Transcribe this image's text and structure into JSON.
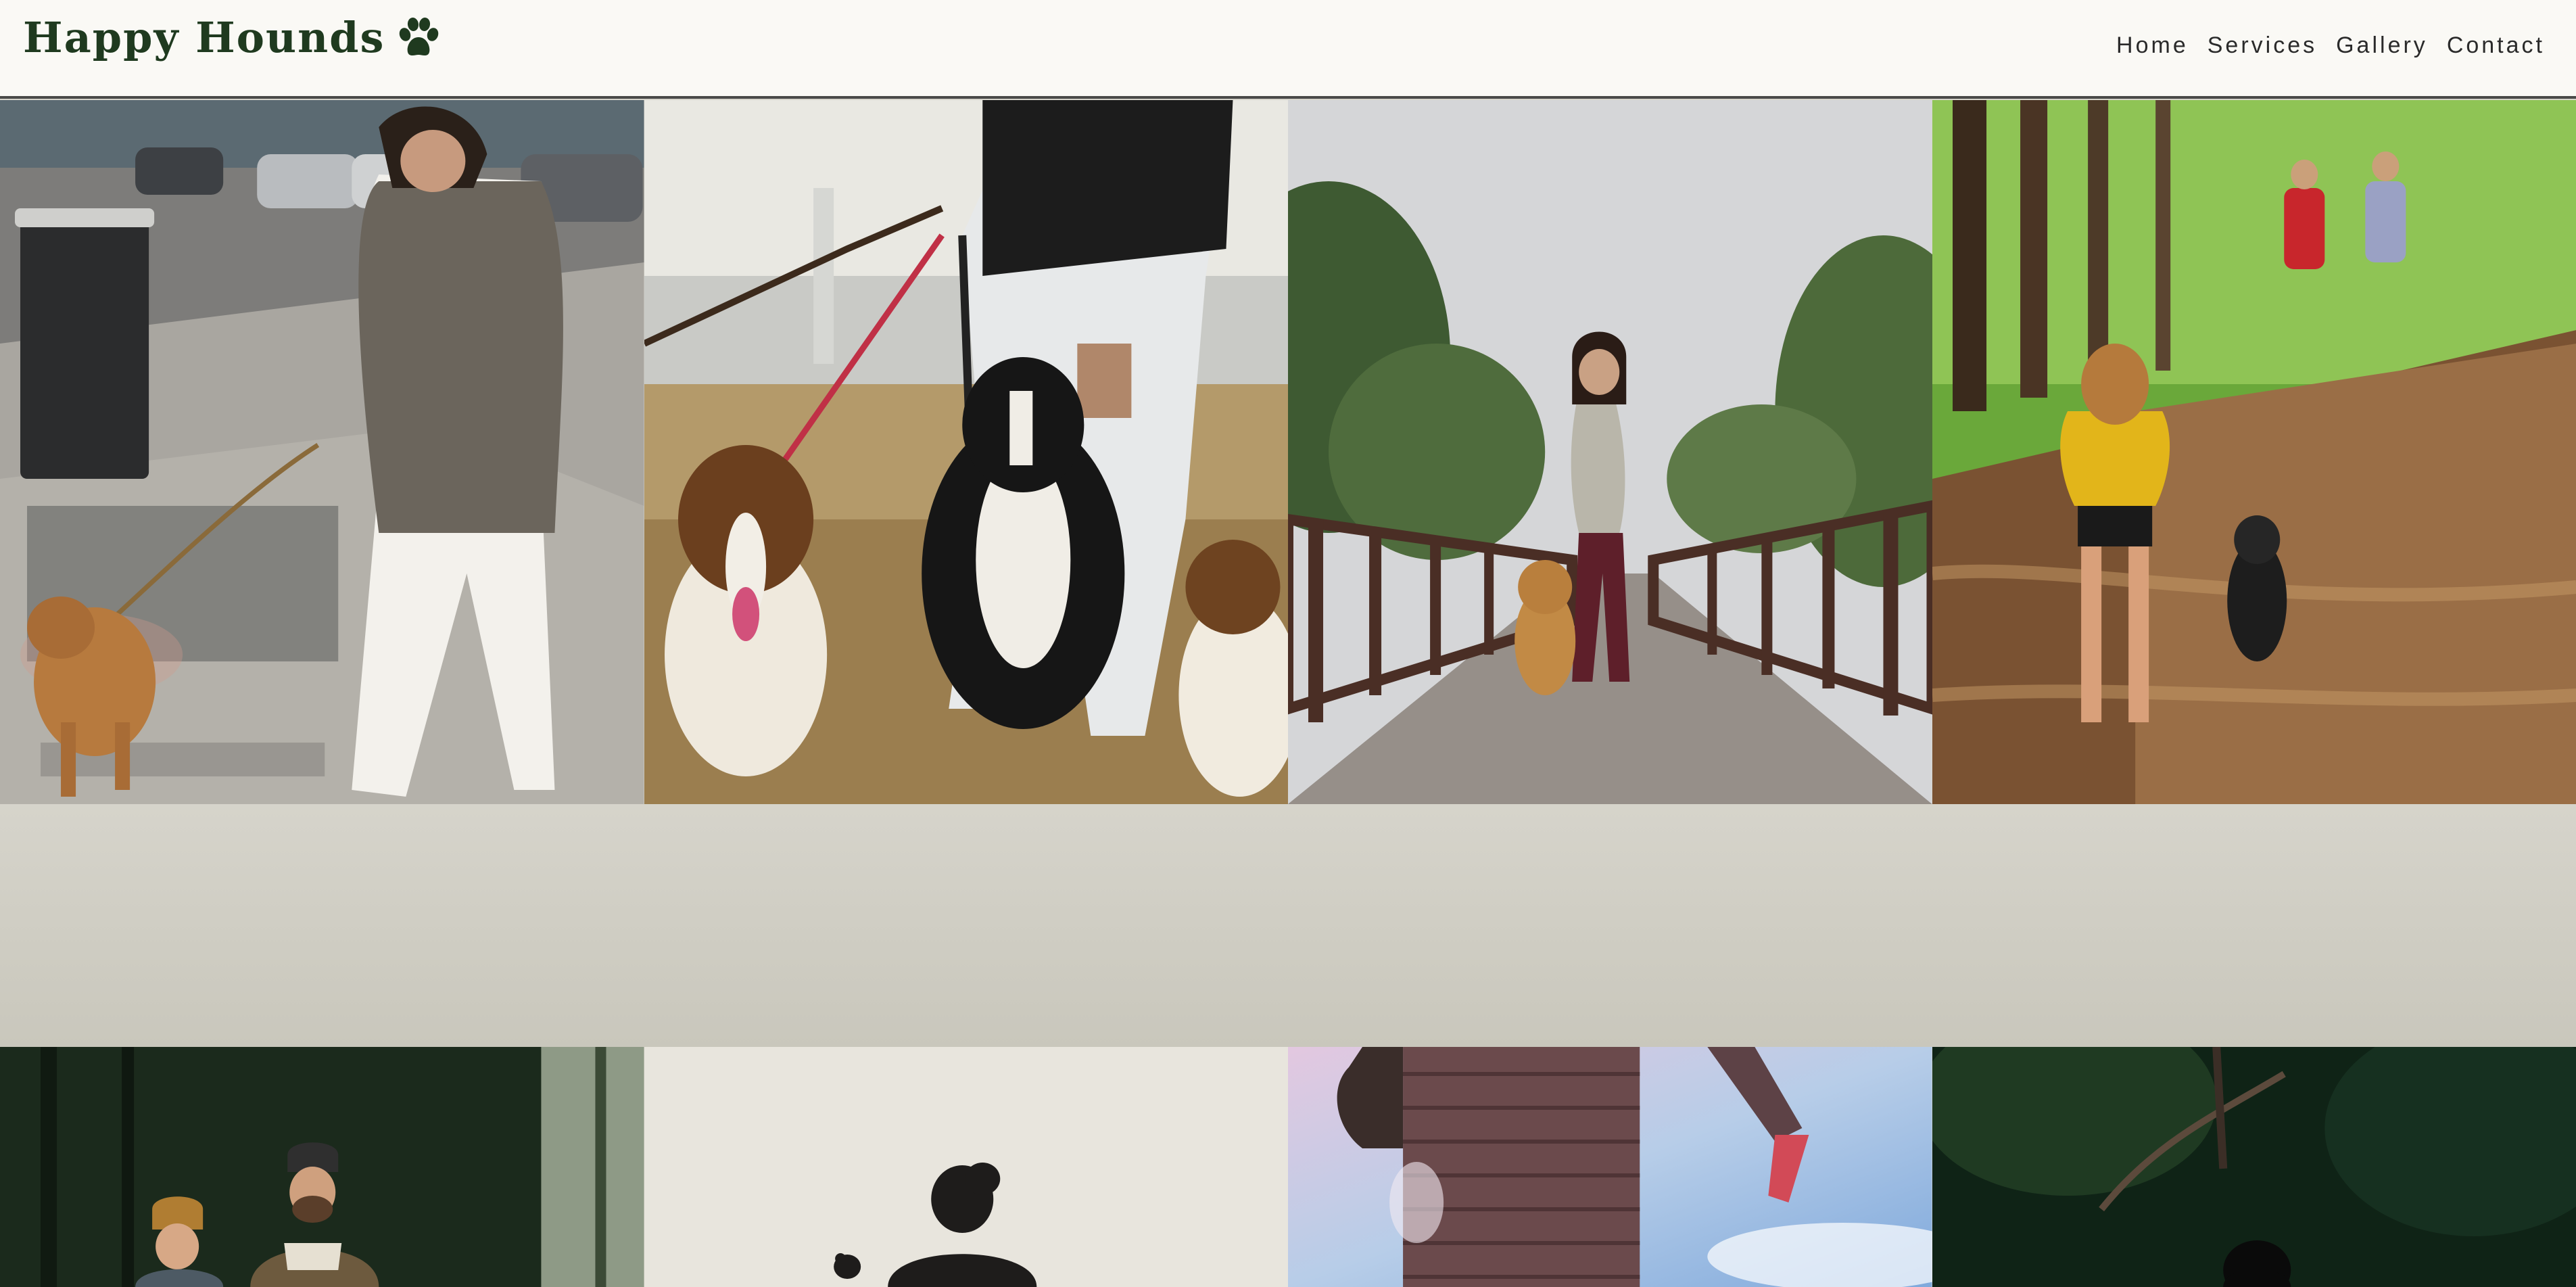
{
  "header": {
    "brand": "Happy Hounds",
    "brand_icon": "paw-icon",
    "nav": [
      {
        "label": "Home"
      },
      {
        "label": "Services"
      },
      {
        "label": "Gallery"
      },
      {
        "label": "Contact"
      }
    ]
  },
  "gallery": {
    "top_row": [
      {
        "icon": "photo-city-dog-walk"
      },
      {
        "icon": "photo-collies-on-leash"
      },
      {
        "icon": "photo-boardwalk-golden-retriever"
      },
      {
        "icon": "photo-forest-trail-dog"
      }
    ],
    "bottom_row": [
      {
        "icon": "photo-couple-in-woods"
      },
      {
        "icon": "photo-silhouette-walker"
      },
      {
        "icon": "photo-puffer-jacket-sky"
      },
      {
        "icon": "photo-dark-forest"
      }
    ]
  },
  "colors": {
    "header_bg": "#faf9f5",
    "brand_text": "#1f3a1f",
    "page_bg": "#d6d4cb"
  }
}
